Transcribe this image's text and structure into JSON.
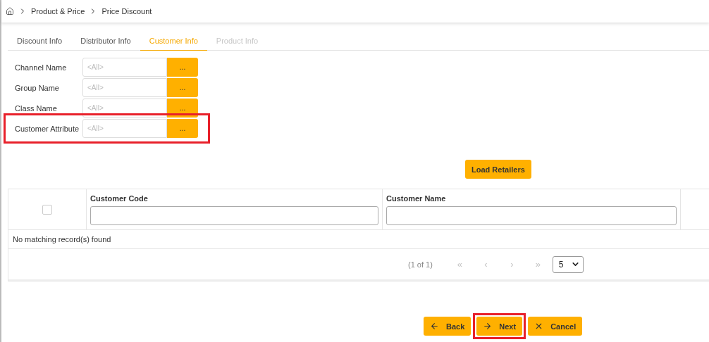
{
  "breadcrumb": [
    "Product & Price",
    "Price Discount"
  ],
  "tabs": [
    {
      "label": "Discount Info",
      "selected": false,
      "disabled": false
    },
    {
      "label": "Distributor Info",
      "selected": false,
      "disabled": false
    },
    {
      "label": "Customer Info",
      "selected": true,
      "disabled": false
    },
    {
      "label": "Product Info",
      "selected": false,
      "disabled": true
    }
  ],
  "filters": [
    {
      "label": "Channel Name",
      "placeholder": "<All>",
      "button": "...",
      "highlighted": false
    },
    {
      "label": "Group Name",
      "placeholder": "<All>",
      "button": "...",
      "highlighted": false
    },
    {
      "label": "Class Name",
      "placeholder": "<All>",
      "button": "...",
      "highlighted": false
    },
    {
      "label": "Customer Attribute",
      "placeholder": "<All>",
      "button": "...",
      "highlighted": true
    }
  ],
  "load_button": "Load Retailers",
  "table": {
    "select_all_checked": false,
    "columns": [
      "Customer Code",
      "Customer Name"
    ],
    "empty_message": "No matching record(s) found"
  },
  "pager": {
    "info": "(1 of 1)",
    "first": "«",
    "prev": "‹",
    "next": "›",
    "last": "»",
    "page_size": "5"
  },
  "actions": [
    {
      "kind": "back",
      "label": "Back",
      "highlighted": false
    },
    {
      "kind": "next",
      "label": "Next",
      "highlighted": true
    },
    {
      "kind": "cancel",
      "label": "Cancel",
      "highlighted": false
    }
  ]
}
